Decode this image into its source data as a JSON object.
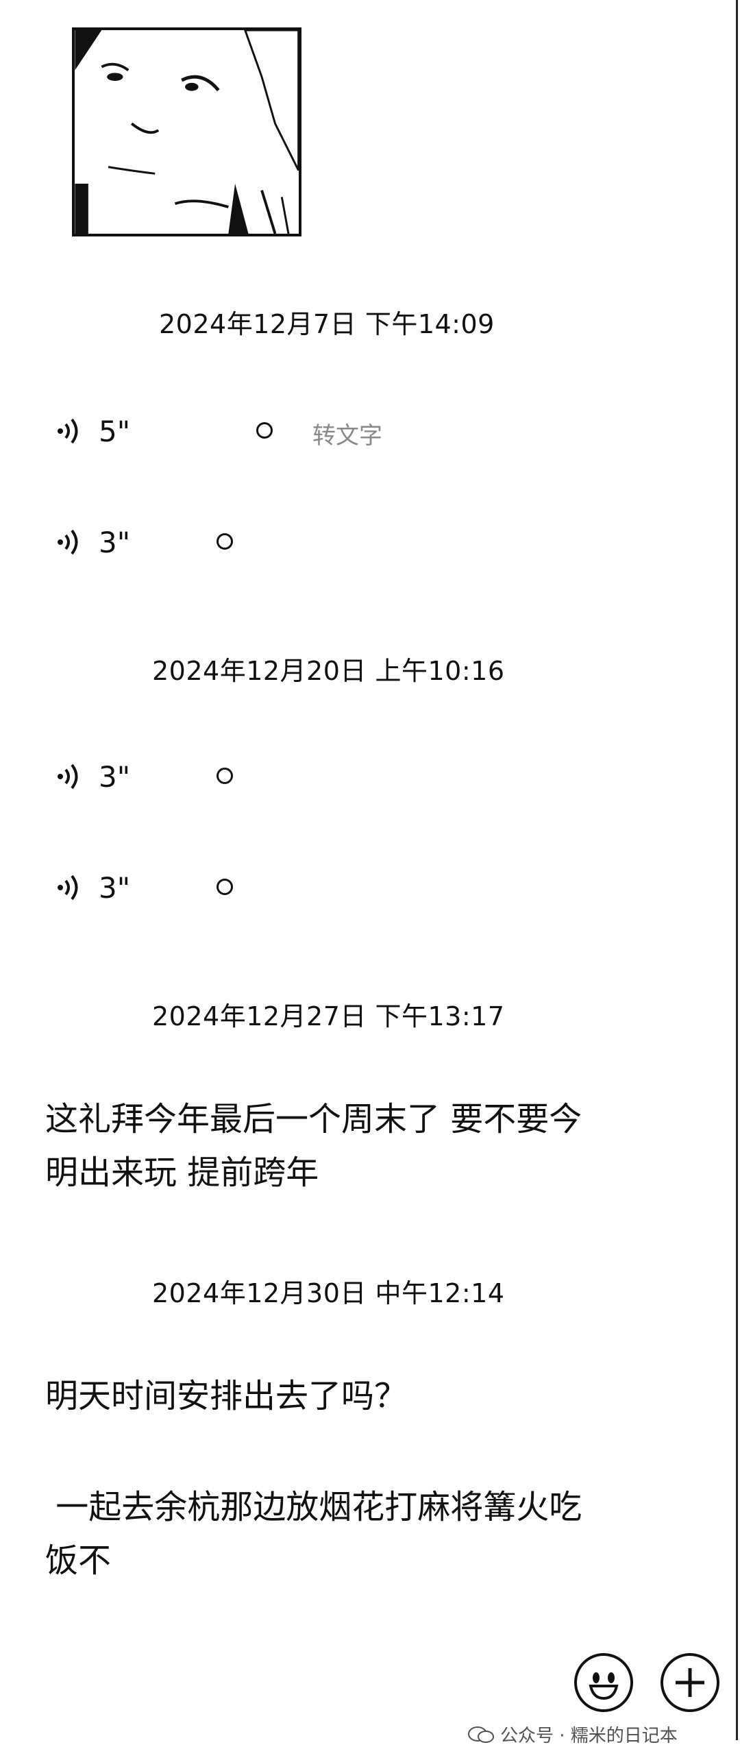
{
  "timestamps": [
    "2024年12月7日 下午14:09",
    "2024年12月20日 上午10:16",
    "2024年12月27日 下午13:17",
    "2024年12月30日 中午12:14"
  ],
  "voice_messages": [
    {
      "duration": "5\"",
      "to_text_label": "转文字"
    },
    {
      "duration": "3\""
    },
    {
      "duration": "3\""
    },
    {
      "duration": "3\""
    }
  ],
  "text_messages": [
    "这礼拜今年最后一个周末了 要不要今明出来玩 提前跨年",
    "明天时间安排出去了吗？",
    " 一起去余杭那边放烟花打麻将篝火吃饭不"
  ],
  "footer": {
    "emoji_button_icon": "smiley-icon",
    "add_button_icon": "plus-icon",
    "watermark": "公众号 · 糯米的日记本"
  }
}
